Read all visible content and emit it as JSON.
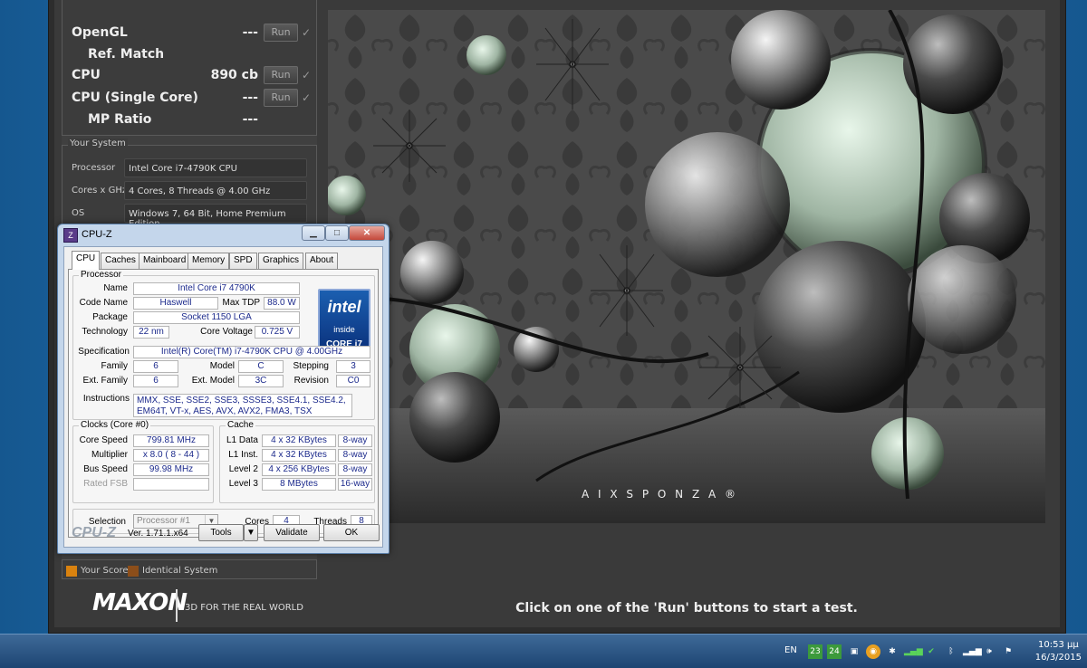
{
  "tests": [
    {
      "name": "OpenGL",
      "value": "---",
      "run": "Run",
      "check": "✓",
      "indent": false
    },
    {
      "name": "Ref. Match",
      "value": "",
      "run": "",
      "check": "",
      "indent": true
    },
    {
      "name": "CPU",
      "value": "890 cb",
      "run": "Run",
      "check": "✓",
      "indent": false
    },
    {
      "name": "CPU (Single Core)",
      "value": "---",
      "run": "Run",
      "check": "✓",
      "indent": false
    },
    {
      "name": "MP Ratio",
      "value": "---",
      "run": "",
      "check": "",
      "indent": true
    }
  ],
  "your_system": {
    "title": "Your System",
    "rows": [
      {
        "label": "Processor",
        "value": "Intel Core i7-4790K CPU"
      },
      {
        "label": "Cores x GHz",
        "value": "4 Cores, 8 Threads @ 4.00 GHz"
      },
      {
        "label": "OS",
        "value": "Windows 7, 64 Bit, Home Premium Edition"
      }
    ]
  },
  "legend": {
    "your_score": "Your Score",
    "identical": "Identical System",
    "your_color": "#d9820f",
    "identical_color": "#8c4e1a"
  },
  "render_credit": "A I X S P O N Z A ®",
  "maxon": {
    "logo": "MAXON",
    "tagline": "3D FOR THE REAL WORLD"
  },
  "status_message": "Click on one of the 'Run' buttons to start a test.",
  "cpuz": {
    "title": "CPU-Z",
    "icon": "Z",
    "tabs": [
      "CPU",
      "Caches",
      "Mainboard",
      "Memory",
      "SPD",
      "Graphics",
      "About"
    ],
    "processor_group": "Processor",
    "name_label": "Name",
    "name": "Intel Core i7 4790K",
    "codename_label": "Code Name",
    "codename": "Haswell",
    "maxtdp_label": "Max TDP",
    "maxtdp": "88.0 W",
    "package_label": "Package",
    "package": "Socket 1150 LGA",
    "tech_label": "Technology",
    "tech": "22 nm",
    "voltage_label": "Core Voltage",
    "voltage": "0.725 V",
    "spec_label": "Specification",
    "spec": "Intel(R) Core(TM) i7-4790K CPU @ 4.00GHz",
    "family_label": "Family",
    "family": "6",
    "model_label": "Model",
    "model": "C",
    "stepping_label": "Stepping",
    "stepping": "3",
    "extfamily_label": "Ext. Family",
    "extfamily": "6",
    "extmodel_label": "Ext. Model",
    "extmodel": "3C",
    "revision_label": "Revision",
    "revision": "C0",
    "instr_label": "Instructions",
    "instructions": "MMX, SSE, SSE2, SSE3, SSSE3, SSE4.1, SSE4.2, EM64T, VT-x, AES, AVX, AVX2, FMA3, TSX",
    "intel_brand": "intel",
    "intel_inside": "inside",
    "intel_core": "CORE i7",
    "clocks_group": "Clocks (Core #0)",
    "corespeed_label": "Core Speed",
    "corespeed": "799.81 MHz",
    "multiplier_label": "Multiplier",
    "multiplier": "x 8.0 ( 8 - 44 )",
    "busspeed_label": "Bus Speed",
    "busspeed": "99.98 MHz",
    "ratedfsb_label": "Rated FSB",
    "ratedfsb": "",
    "cache_group": "Cache",
    "l1d_label": "L1 Data",
    "l1d": "4 x 32 KBytes",
    "l1d_way": "8-way",
    "l1i_label": "L1 Inst.",
    "l1i": "4 x 32 KBytes",
    "l1i_way": "8-way",
    "l2_label": "Level 2",
    "l2": "4 x 256 KBytes",
    "l2_way": "8-way",
    "l3_label": "Level 3",
    "l3": "8 MBytes",
    "l3_way": "16-way",
    "selection_label": "Selection",
    "selection": "Processor #1",
    "cores_label": "Cores",
    "cores": "4",
    "threads_label": "Threads",
    "threads": "8",
    "logo": "CPU-Z",
    "version": "Ver. 1.71.1.x64",
    "tools": "Tools",
    "validate": "Validate",
    "ok": "OK"
  },
  "taskbar": {
    "lang": "EN",
    "badge1": "23",
    "badge2": "24",
    "time": "10:53 μμ",
    "date": "16/3/2015"
  }
}
